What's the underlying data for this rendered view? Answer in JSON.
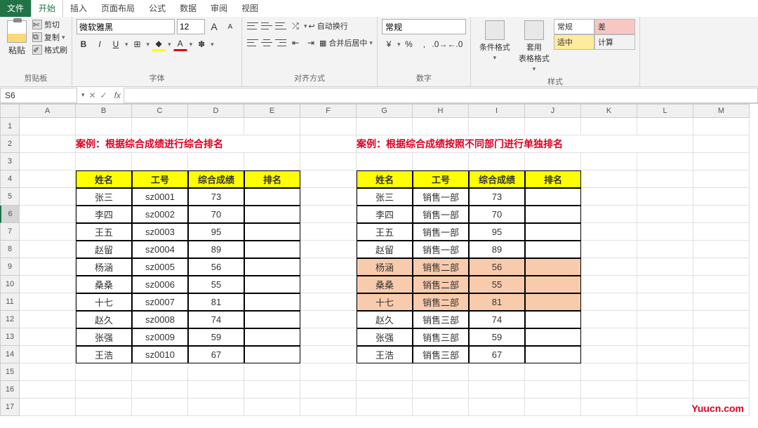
{
  "tabs": {
    "file": "文件",
    "home": "开始",
    "insert": "插入",
    "layout": "页面布局",
    "formula": "公式",
    "data": "数据",
    "review": "审阅",
    "view": "视图"
  },
  "ribbon": {
    "clipboard": {
      "paste": "粘贴",
      "cut": "剪切",
      "copy": "复制",
      "painter": "格式刷",
      "label": "剪贴板"
    },
    "font": {
      "name": "微软雅黑",
      "size": "12",
      "increaseA": "A",
      "decreaseA": "A",
      "bold": "B",
      "italic": "I",
      "underline": "U",
      "border": "⊞",
      "label": "字体"
    },
    "align": {
      "wrap": "自动换行",
      "merge": "合并后居中",
      "label": "对齐方式"
    },
    "number": {
      "format": "常规",
      "label": "数字"
    },
    "styles": {
      "cond": "条件格式",
      "table": "套用\n表格格式",
      "normal": "常规",
      "bad": "差",
      "neutral": "适中",
      "calc": "计算",
      "label": "样式"
    }
  },
  "namebox": "S6",
  "columns": [
    "A",
    "B",
    "C",
    "D",
    "E",
    "F",
    "G",
    "H",
    "I",
    "J",
    "K",
    "L",
    "M"
  ],
  "title1": "案例：根据综合成绩进行综合排名",
  "title2": "案例：根据综合成绩按照不同部门进行单独排名",
  "headers": [
    "姓名",
    "工号",
    "综合成绩",
    "排名"
  ],
  "table1": [
    [
      "张三",
      "sz0001",
      "73",
      ""
    ],
    [
      "李四",
      "sz0002",
      "70",
      ""
    ],
    [
      "王五",
      "sz0003",
      "95",
      ""
    ],
    [
      "赵留",
      "sz0004",
      "89",
      ""
    ],
    [
      "杨涵",
      "sz0005",
      "56",
      ""
    ],
    [
      "桑桑",
      "sz0006",
      "55",
      ""
    ],
    [
      "十七",
      "sz0007",
      "81",
      ""
    ],
    [
      "赵久",
      "sz0008",
      "74",
      ""
    ],
    [
      "张强",
      "sz0009",
      "59",
      ""
    ],
    [
      "王浩",
      "sz0010",
      "67",
      ""
    ]
  ],
  "table2": [
    {
      "row": [
        "张三",
        "销售一部",
        "73",
        ""
      ],
      "hl": false
    },
    {
      "row": [
        "李四",
        "销售一部",
        "70",
        ""
      ],
      "hl": false
    },
    {
      "row": [
        "王五",
        "销售一部",
        "95",
        ""
      ],
      "hl": false
    },
    {
      "row": [
        "赵留",
        "销售一部",
        "89",
        ""
      ],
      "hl": false
    },
    {
      "row": [
        "杨涵",
        "销售二部",
        "56",
        ""
      ],
      "hl": true
    },
    {
      "row": [
        "桑桑",
        "销售二部",
        "55",
        ""
      ],
      "hl": true
    },
    {
      "row": [
        "十七",
        "销售二部",
        "81",
        ""
      ],
      "hl": true
    },
    {
      "row": [
        "赵久",
        "销售三部",
        "74",
        ""
      ],
      "hl": false
    },
    {
      "row": [
        "张强",
        "销售三部",
        "59",
        ""
      ],
      "hl": false
    },
    {
      "row": [
        "王浩",
        "销售三部",
        "67",
        ""
      ],
      "hl": false
    }
  ],
  "watermark": "Yuucn.com"
}
